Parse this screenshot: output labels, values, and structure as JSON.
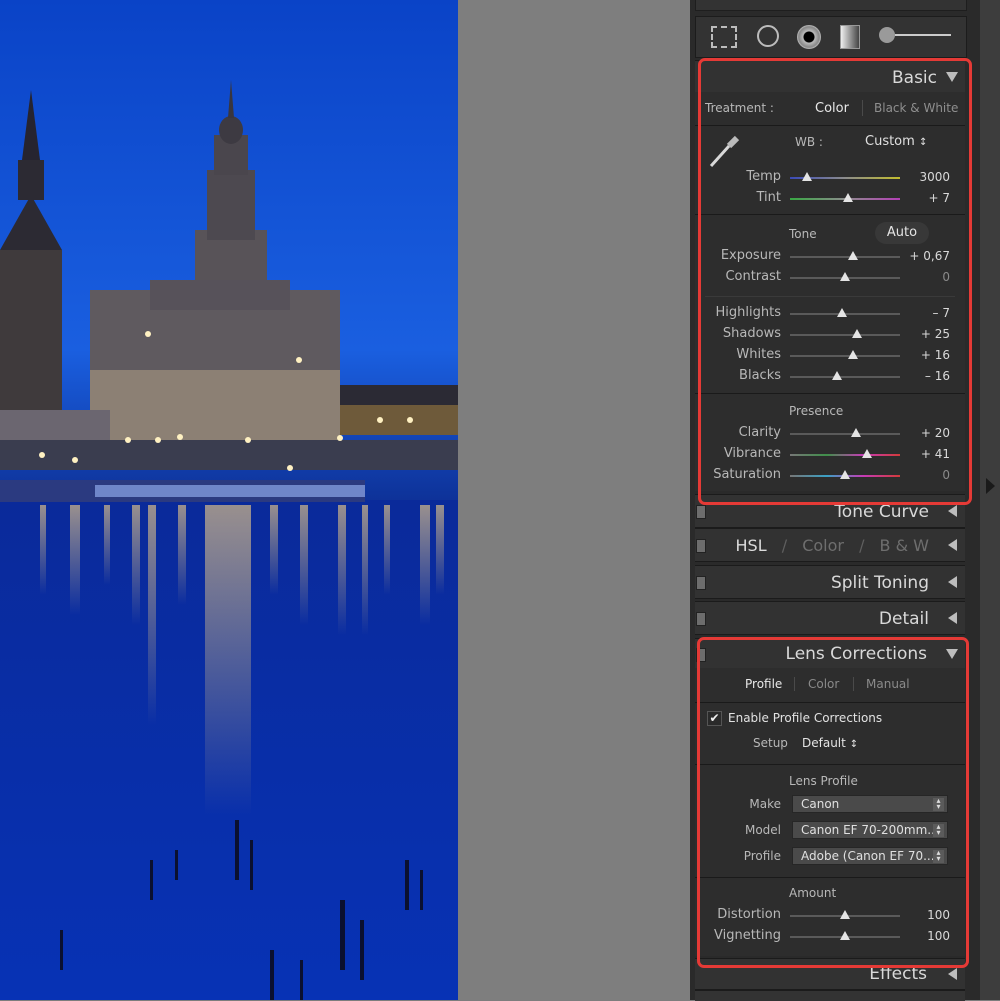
{
  "basic": {
    "title": "Basic",
    "treatment_label": "Treatment :",
    "treatment_color": "Color",
    "treatment_bw": "Black & White",
    "wb_label": "WB :",
    "wb_value": "Custom",
    "wb_arrows": "↕",
    "temp": {
      "label": "Temp",
      "value": "3000",
      "position": 0.15
    },
    "tint": {
      "label": "Tint",
      "value": "+ 7",
      "position": 0.53
    },
    "tone_label": "Tone",
    "auto_label": "Auto",
    "exposure": {
      "label": "Exposure",
      "value": "+ 0,67",
      "position": 0.57
    },
    "contrast": {
      "label": "Contrast",
      "value": "0",
      "position": 0.5
    },
    "highlights": {
      "label": "Highlights",
      "value": "– 7",
      "position": 0.47
    },
    "shadows": {
      "label": "Shadows",
      "value": "+ 25",
      "position": 0.61
    },
    "whites": {
      "label": "Whites",
      "value": "+ 16",
      "position": 0.57
    },
    "blacks": {
      "label": "Blacks",
      "value": "– 16",
      "position": 0.43
    },
    "presence_label": "Presence",
    "clarity": {
      "label": "Clarity",
      "value": "+ 20",
      "position": 0.6
    },
    "vibrance": {
      "label": "Vibrance",
      "value": "+ 41",
      "position": 0.7
    },
    "saturation": {
      "label": "Saturation",
      "value": "0",
      "position": 0.5
    }
  },
  "panels": {
    "tone_curve": "Tone Curve",
    "hsl": "HSL",
    "slash": "/",
    "color": "Color",
    "bw": "B & W",
    "split_toning": "Split Toning",
    "detail": "Detail",
    "effects": "Effects"
  },
  "lens": {
    "title": "Lens Corrections",
    "tab_profile": "Profile",
    "tab_color": "Color",
    "tab_manual": "Manual",
    "enable_label": "Enable Profile Corrections",
    "enable_checked": true,
    "checkmark": "✔",
    "setup_label": "Setup",
    "setup_value": "Default",
    "setup_arrows": "↕",
    "lens_profile_label": "Lens Profile",
    "make_label": "Make",
    "make_value": "Canon",
    "model_label": "Model",
    "model_value": "Canon EF 70-200mm...",
    "profile_label": "Profile",
    "profile_value": "Adobe (Canon EF 70...",
    "amount_label": "Amount",
    "distortion": {
      "label": "Distortion",
      "value": "100",
      "position": 0.5
    },
    "vignetting": {
      "label": "Vignetting",
      "value": "100",
      "position": 0.5
    }
  },
  "tools": [
    "crop-overlay-icon",
    "spot-removal-icon",
    "red-eye-icon",
    "graduated-filter-icon",
    "adjustment-brush-icon"
  ],
  "colors": {
    "highlight_box": "#e53a36",
    "panel_bg": "#2a2a2a",
    "header_bg": "#323232"
  }
}
